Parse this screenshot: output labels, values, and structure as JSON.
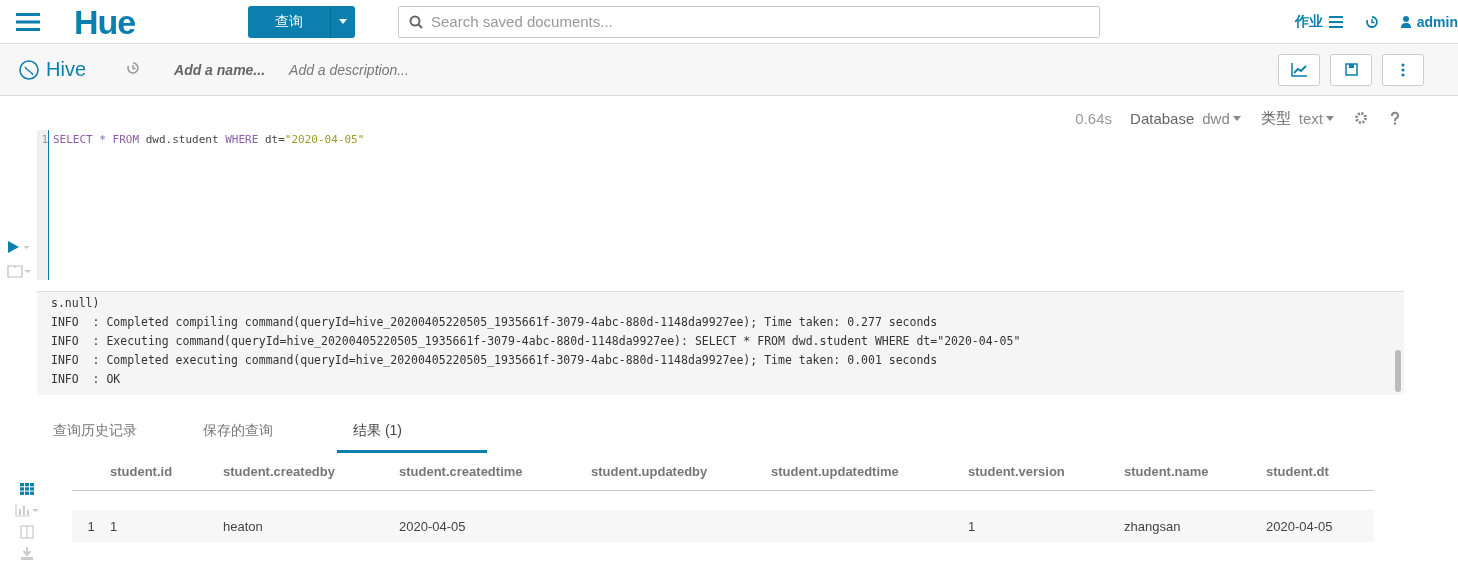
{
  "topbar": {
    "logo": "Hue",
    "query_button": "查询",
    "search": {
      "placeholder": "Search saved documents..."
    },
    "jobs_label": "作业",
    "user": "admin"
  },
  "toolbar": {
    "app": "Hive",
    "name_placeholder": "Add a name...",
    "description_placeholder": "Add a description..."
  },
  "editor_meta": {
    "time": "0.64s",
    "database_label": "Database",
    "database": "dwd",
    "type_label": "类型",
    "type": "text"
  },
  "editor": {
    "line_number": "1",
    "tokens": [
      {
        "text": "SELECT * FROM",
        "kind": "keyword"
      },
      {
        "text": " dwd.student ",
        "kind": "plain"
      },
      {
        "text": "WHERE",
        "kind": "keyword"
      },
      {
        "text": " dt=",
        "kind": "plain"
      },
      {
        "text": "\"2020-04-05\"",
        "kind": "string"
      }
    ]
  },
  "log": [
    "s.null)",
    "INFO  : Completed compiling command(queryId=hive_20200405220505_1935661f-3079-4abc-880d-1148da9927ee); Time taken: 0.277 seconds",
    "INFO  : Executing command(queryId=hive_20200405220505_1935661f-3079-4abc-880d-1148da9927ee): SELECT * FROM dwd.student WHERE dt=\"2020-04-05\"",
    "INFO  : Completed executing command(queryId=hive_20200405220505_1935661f-3079-4abc-880d-1148da9927ee); Time taken: 0.001 seconds",
    "INFO  : OK"
  ],
  "tabs": [
    {
      "label": "查询历史记录",
      "selected": false
    },
    {
      "label": "保存的查询",
      "selected": false
    },
    {
      "label": "结果 (1)",
      "selected": true
    }
  ],
  "table": {
    "columns": [
      "student.id",
      "student.createdby",
      "student.createdtime",
      "student.updatedby",
      "student.updatedtime",
      "student.version",
      "student.name",
      "student.dt"
    ],
    "rows": [
      {
        "number": "1",
        "cells": [
          "1",
          "heaton",
          "2020-04-05",
          null,
          null,
          "1",
          "zhangsan",
          "2020-04-05"
        ]
      }
    ]
  }
}
